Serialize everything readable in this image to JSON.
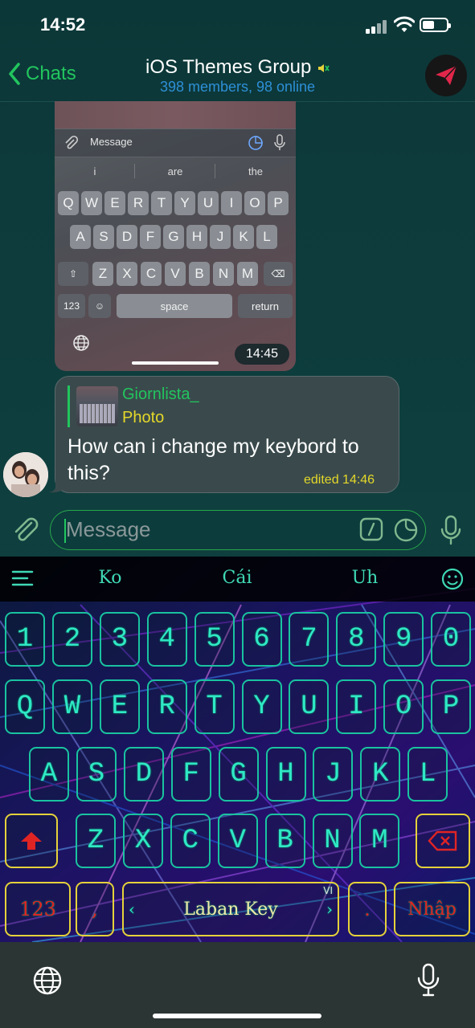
{
  "status_bar": {
    "time": "14:52"
  },
  "nav": {
    "back_label": "Chats",
    "title": "iOS Themes Group",
    "subtitle": "398 members, 98 online"
  },
  "screenshot_message": {
    "message_placeholder": "Message",
    "suggestions": [
      "i",
      "are",
      "the"
    ],
    "row1": [
      "Q",
      "W",
      "E",
      "R",
      "T",
      "Y",
      "U",
      "I",
      "O",
      "P"
    ],
    "row2": [
      "A",
      "S",
      "D",
      "F",
      "G",
      "H",
      "J",
      "K",
      "L"
    ],
    "row3": [
      "Z",
      "X",
      "C",
      "V",
      "B",
      "N",
      "M"
    ],
    "num_label": "123",
    "space_label": "space",
    "return_label": "return",
    "time": "14:45"
  },
  "bubble": {
    "reply_name": "Giornlista_",
    "reply_type": "Photo",
    "text": "How can i change my keybord to this?",
    "edited": "edited 14:46"
  },
  "input": {
    "placeholder": "Message"
  },
  "keyboard": {
    "suggestions": [
      "Ko",
      "Cái",
      "Uh"
    ],
    "numbers": [
      "1",
      "2",
      "3",
      "4",
      "5",
      "6",
      "7",
      "8",
      "9",
      "0"
    ],
    "row1": [
      "Q",
      "W",
      "E",
      "R",
      "T",
      "Y",
      "U",
      "I",
      "O",
      "P"
    ],
    "row2": [
      "A",
      "S",
      "D",
      "F",
      "G",
      "H",
      "J",
      "K",
      "L"
    ],
    "row3": [
      "Z",
      "X",
      "C",
      "V",
      "B",
      "N",
      "M"
    ],
    "num_label": "123",
    "comma": ",",
    "space_label": "Laban Key",
    "lang": "VI",
    "period": ".",
    "enter_label": "Nhập",
    "colors": {
      "key_border": "#19c3a0",
      "key_text": "#2fe8c6",
      "special_border": "#e5d23a",
      "special_text": "#e02424"
    }
  }
}
